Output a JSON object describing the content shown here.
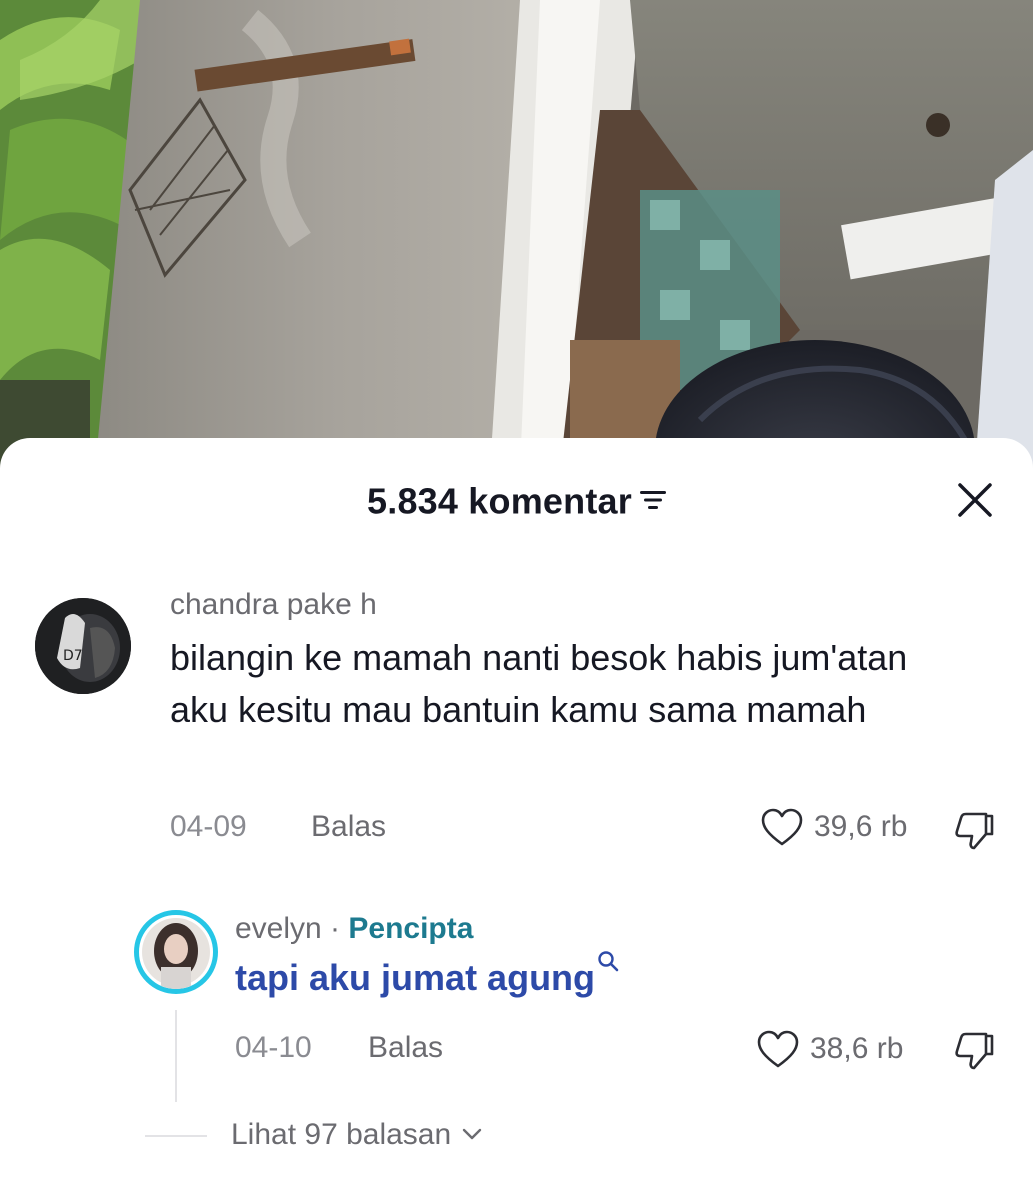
{
  "header": {
    "comment_count": "5.834 komentar"
  },
  "comments": [
    {
      "username": "chandra pake h",
      "text": "bilangin ke mamah nanti besok habis jum'atan aku kesitu mau bantuin kamu sama mamah",
      "date": "04-09",
      "reply_label": "Balas",
      "likes": "39,6 rb"
    }
  ],
  "replies": [
    {
      "username": "evelyn",
      "separator": " · ",
      "creator_tag": "Pencipta",
      "text": "tapi aku jumat agung",
      "date": "04-10",
      "reply_label": "Balas",
      "likes": "38,6 rb"
    }
  ],
  "view_replies_label": "Lihat 97 balasan",
  "colors": {
    "text_primary": "#161823",
    "text_secondary": "#6b6b70",
    "creator_tag": "#1d7a8f",
    "link_text": "#2d4aa8",
    "avatar_ring": "#26c6e6"
  },
  "icons": [
    "sort-icon",
    "close-icon",
    "heart-icon",
    "dislike-icon",
    "search-icon",
    "chevron-down-icon"
  ]
}
